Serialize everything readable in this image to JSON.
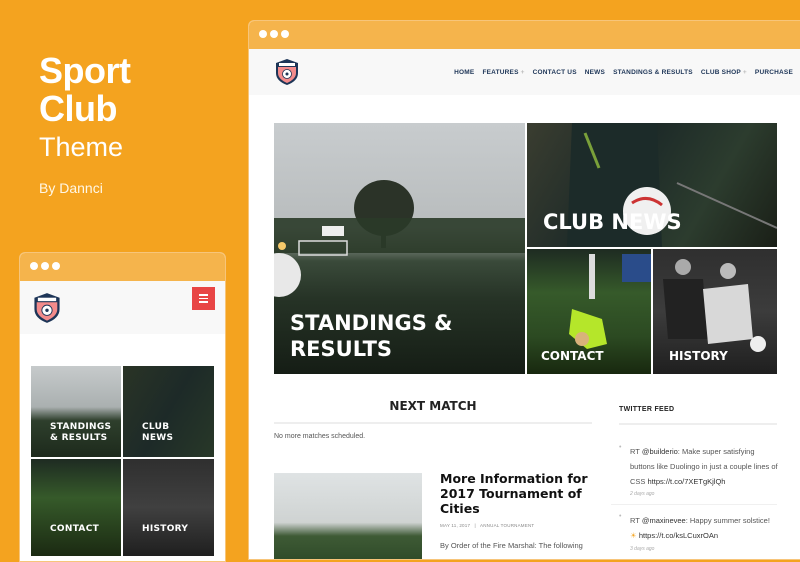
{
  "promo": {
    "title_line1": "Sport",
    "title_line2": "Club",
    "subtitle": "Theme",
    "author": "By Dannci",
    "background_color": "#f4a31f"
  },
  "desktop": {
    "window_bar_color": "#f5b44c",
    "logo_icon": "club-crest-icon",
    "menu": [
      {
        "label": "HOME",
        "has_submenu": false
      },
      {
        "label": "FEATURES",
        "has_submenu": true
      },
      {
        "label": "CONTACT US",
        "has_submenu": false
      },
      {
        "label": "NEWS",
        "has_submenu": false
      },
      {
        "label": "STANDINGS & RESULTS",
        "has_submenu": false
      },
      {
        "label": "CLUB SHOP",
        "has_submenu": true
      },
      {
        "label": "PURCHASE",
        "has_submenu": false
      }
    ],
    "submenu_indicator": "+",
    "tiles": {
      "standings": "STANDINGS & RESULTS",
      "standings_l1": "STANDINGS &",
      "standings_l2": "RESULTS",
      "news": "CLUB NEWS",
      "contact": "CONTACT",
      "history": "HISTORY"
    },
    "next_match": {
      "title": "NEXT MATCH",
      "text": "No more matches scheduled."
    },
    "post": {
      "title": "More Information for 2017 Tournament of Cities",
      "date": "MAY 11, 2017",
      "separator": "|",
      "category": "ANNUAL TOURNAMENT",
      "excerpt": "By Order of the Fire Marshal: The following"
    },
    "twitter": {
      "title": "TWITTER FEED",
      "tweets": [
        {
          "prefix": "RT",
          "handle": "@builderio",
          "text": ": Make super satisfying buttons like Duolingo in just a couple lines of CSS",
          "link": "https://t.co/7XETgKjlQh",
          "ago": "2 days ago"
        },
        {
          "prefix": "RT",
          "handle": "@maxinevee",
          "text": ": Happy summer solstice!",
          "emoji": "☀",
          "link": "https://t.co/ksLCuxrOAn",
          "ago": "3 days ago"
        }
      ]
    }
  },
  "mobile": {
    "menu_button_color": "#e84545",
    "tiles": {
      "standings_l1": "STANDINGS",
      "standings_l2": "& RESULTS",
      "news_l1": "CLUB",
      "news_l2": "NEWS",
      "contact": "CONTACT",
      "history": "HISTORY"
    }
  }
}
